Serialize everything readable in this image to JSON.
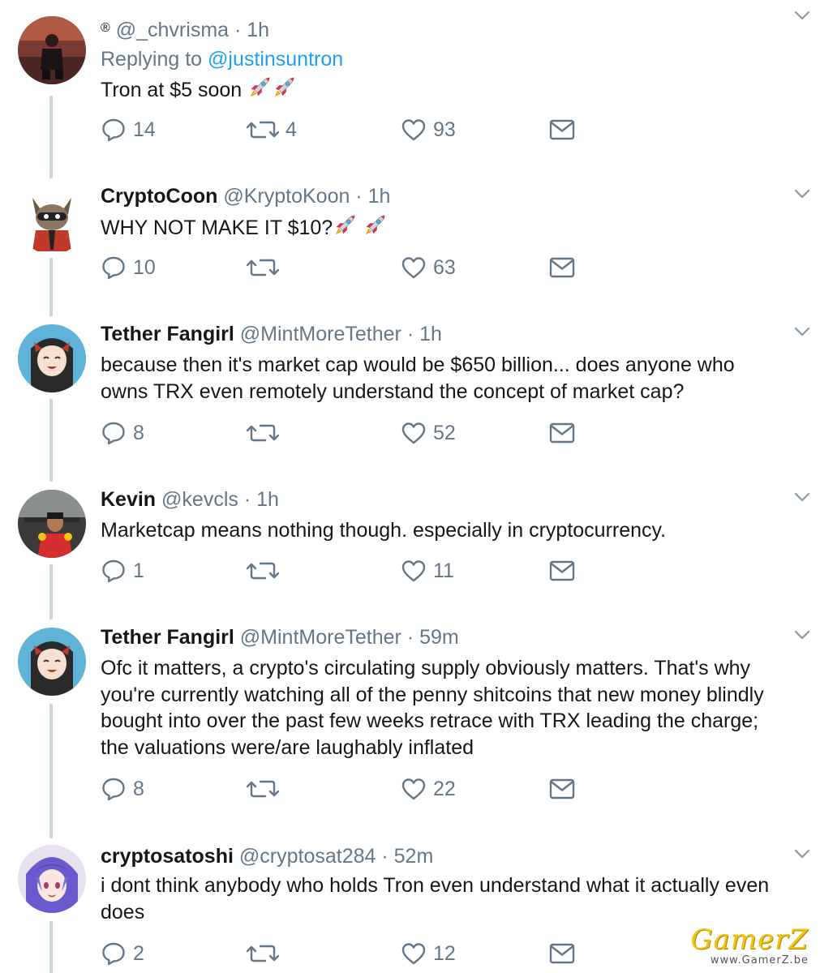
{
  "tweets": [
    {
      "verified_mark": "®",
      "name": "",
      "handle": "@_chvrisma",
      "time": "1h",
      "reply_prefix": "Replying to",
      "reply_mention": "@justinsuntron",
      "text": "Tron at $5 soon",
      "emoji": [
        "rocket-emoji",
        "rocket-emoji"
      ],
      "replies": "14",
      "retweets": "4",
      "likes": "93"
    },
    {
      "name": "CryptoCoon",
      "handle": "@KryptoKoon",
      "time": "1h",
      "text": "WHY NOT MAKE IT $10?",
      "emoji": [
        "rocket-emoji",
        "rocket-emoji"
      ],
      "replies": "10",
      "retweets": "",
      "likes": "63"
    },
    {
      "name": "Tether Fangirl",
      "handle": "@MintMoreTether",
      "time": "1h",
      "text_lines": [
        "because then it's market cap would be $650 billion... does anyone who",
        "owns TRX even remotely understand the concept of market cap?"
      ],
      "replies": "8",
      "retweets": "",
      "likes": "52"
    },
    {
      "name": "Kevin",
      "handle": "@kevcls",
      "time": "1h",
      "text": "Marketcap means nothing though. especially in cryptocurrency.",
      "replies": "1",
      "retweets": "",
      "likes": "11"
    },
    {
      "name": "Tether Fangirl",
      "handle": "@MintMoreTether",
      "time": "59m",
      "text_lines": [
        "Ofc it matters, a crypto's circulating supply obviously matters. That's why",
        "you're currently watching all of the penny shitcoins that new money blindly",
        "bought into over the past few weeks retrace with TRX leading the charge;",
        "the valuations were/are laughably inflated"
      ],
      "replies": "8",
      "retweets": "",
      "likes": "22"
    },
    {
      "name": "cryptosatoshi",
      "handle": "@cryptosat284",
      "time": "52m",
      "text_lines": [
        "i dont think anybody who holds Tron even understand what it actually even",
        "does"
      ],
      "replies": "2",
      "retweets": "",
      "likes": "12"
    }
  ],
  "separator": "·",
  "icons": [
    "reply-icon",
    "retweet-icon",
    "like-icon",
    "message-icon",
    "chevron-down-icon"
  ],
  "colors": {
    "text": "#14171a",
    "muted": "#657786",
    "link": "#1da1f2",
    "thread": "#ccd6dd"
  },
  "watermark": {
    "logo": "GamerZ",
    "url": "www.GamerZ.be"
  }
}
